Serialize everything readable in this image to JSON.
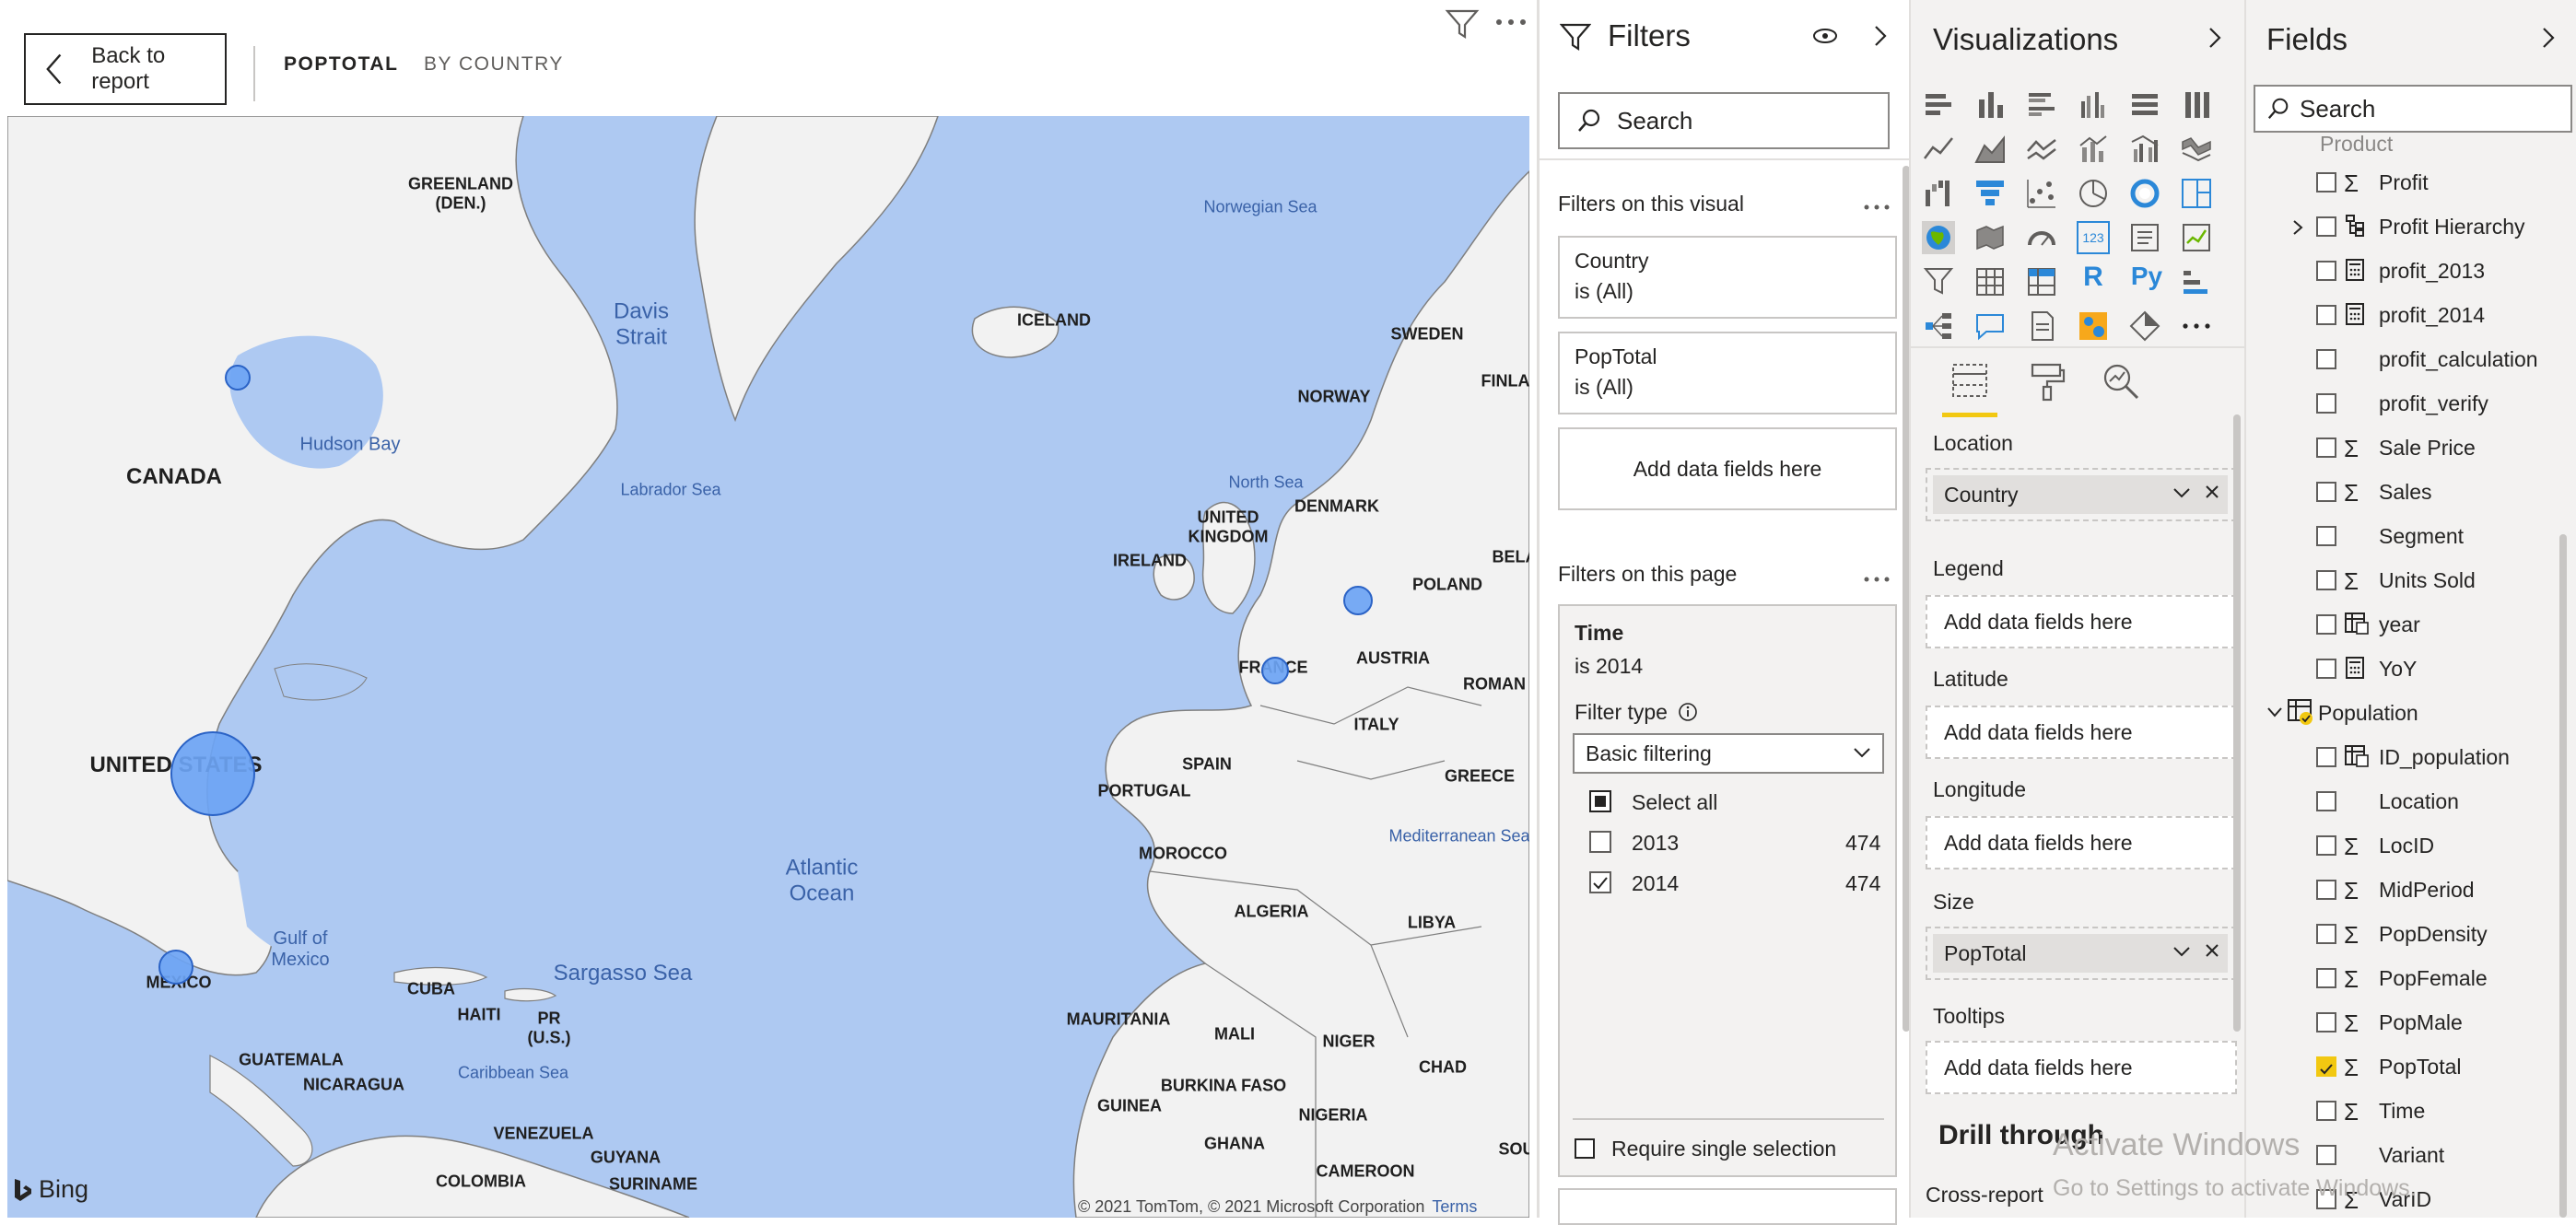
{
  "report": {
    "back_label": "Back to report",
    "tabs": [
      {
        "label": "POPTOTAL",
        "active": true
      },
      {
        "label": "BY COUNTRY",
        "active": false
      }
    ],
    "map": {
      "provider": "Bing",
      "copyright": "© 2021 TomTom, © 2021 Microsoft Corporation",
      "terms": "Terms",
      "labels": {
        "greenland": "GREENLAND\n(DEN.)",
        "iceland": "ICELAND",
        "sweden": "SWEDEN",
        "finland": "FINLA",
        "norway": "NORWAY",
        "canada": "CANADA",
        "uk": "UNITED\nKINGDOM",
        "ireland": "IRELAND",
        "denmark": "DENMARK",
        "poland": "POLAND",
        "belarus": "BELA",
        "france": "FRANCE",
        "austria": "AUSTRIA",
        "romania": "ROMAN",
        "italy": "ITALY",
        "us": "UNITED STATES",
        "spain": "SPAIN",
        "portugal": "PORTUGAL",
        "greece": "GREECE",
        "morocco": "MOROCCO",
        "algeria": "ALGERIA",
        "libya": "LIBYA",
        "mexico": "MEXICO",
        "cuba": "CUBA",
        "haiti": "HAITI",
        "pr": "PR\n(U.S.)",
        "mauritania": "MAURITANIA",
        "mali": "MALI",
        "niger": "NIGER",
        "chad": "CHAD",
        "guatemala": "GUATEMALA",
        "nicaragua": "NICARAGUA",
        "burkina": "BURKINA FASO",
        "guinea": "GUINEA",
        "nigeria": "NIGERIA",
        "venezuela": "VENEZUELA",
        "guyana": "GUYANA",
        "suriname": "SURINAME",
        "ghana": "GHANA",
        "cameroon": "CAMEROON",
        "colombia": "COLOMBIA",
        "south": "SOU",
        "davis": "Davis\nStrait",
        "hudson": "Hudson Bay",
        "labrador": "Labrador Sea",
        "norwegian": "Norwegian Sea",
        "northsea": "North Sea",
        "atlantic": "Atlantic\nOcean",
        "gulf": "Gulf of\nMexico",
        "sargasso": "Sargasso Sea",
        "caribbean": "Caribbean Sea",
        "mediterranean": "Mediterranean Sea"
      }
    }
  },
  "filters": {
    "title": "Filters",
    "search_placeholder": "Search",
    "on_visual_label": "Filters on this visual",
    "visual_filters": [
      {
        "field": "Country",
        "state": "is (All)"
      },
      {
        "field": "PopTotal",
        "state": "is (All)"
      }
    ],
    "add_fields": "Add data fields here",
    "on_page_label": "Filters on this page",
    "page_filter": {
      "field": "Time",
      "state": "is 2014",
      "filter_type_label": "Filter type",
      "filter_type_value": "Basic filtering",
      "select_all": "Select all",
      "options": [
        {
          "label": "2013",
          "count": "474",
          "checked": false
        },
        {
          "label": "2014",
          "count": "474",
          "checked": true
        }
      ],
      "require_single": "Require single selection"
    }
  },
  "visualizations": {
    "title": "Visualizations",
    "wells": [
      {
        "label": "Location",
        "value": "Country"
      },
      {
        "label": "Legend",
        "value": "Add data fields here"
      },
      {
        "label": "Latitude",
        "value": "Add data fields here"
      },
      {
        "label": "Longitude",
        "value": "Add data fields here"
      },
      {
        "label": "Size",
        "value": "PopTotal"
      },
      {
        "label": "Tooltips",
        "value": "Add data fields here"
      }
    ],
    "drill_through": "Drill through",
    "cross_report": "Cross-report",
    "watermark": "Activate Windows",
    "watermark_sub": "Go to Settings to activate Windows.",
    "icon_r": "R",
    "icon_py": "Py",
    "icon_123": "123"
  },
  "fields": {
    "title": "Fields",
    "search_placeholder": "Search",
    "cut_item": "Product",
    "items": [
      {
        "label": "Profit",
        "icon": "sigma",
        "checked": false
      },
      {
        "label": "Profit Hierarchy",
        "icon": "hierarchy",
        "checked": false,
        "expand": true
      },
      {
        "label": "profit_2013",
        "icon": "calc",
        "checked": false
      },
      {
        "label": "profit_2014",
        "icon": "calc",
        "checked": false
      },
      {
        "label": "profit_calculation",
        "icon": "none",
        "checked": false
      },
      {
        "label": "profit_verify",
        "icon": "none",
        "checked": false
      },
      {
        "label": "Sale Price",
        "icon": "sigma",
        "checked": false
      },
      {
        "label": "Sales",
        "icon": "sigma",
        "checked": false
      },
      {
        "label": "Segment",
        "icon": "none",
        "checked": false
      },
      {
        "label": "Units Sold",
        "icon": "sigma",
        "checked": false
      },
      {
        "label": "year",
        "icon": "table-calc",
        "checked": false
      },
      {
        "label": "YoY",
        "icon": "calc",
        "checked": false
      }
    ],
    "table": "Population",
    "table_items": [
      {
        "label": "ID_population",
        "icon": "table-calc",
        "checked": false
      },
      {
        "label": "Location",
        "icon": "none",
        "checked": false
      },
      {
        "label": "LocID",
        "icon": "sigma",
        "checked": false
      },
      {
        "label": "MidPeriod",
        "icon": "sigma",
        "checked": false
      },
      {
        "label": "PopDensity",
        "icon": "sigma",
        "checked": false
      },
      {
        "label": "PopFemale",
        "icon": "sigma",
        "checked": false
      },
      {
        "label": "PopMale",
        "icon": "sigma",
        "checked": false
      },
      {
        "label": "PopTotal",
        "icon": "sigma",
        "checked": true
      },
      {
        "label": "Time",
        "icon": "sigma",
        "checked": false
      },
      {
        "label": "Variant",
        "icon": "none",
        "checked": false
      },
      {
        "label": "VarID",
        "icon": "sigma",
        "checked": false
      }
    ]
  },
  "colors": {
    "accent": "#f2c811",
    "bubble": "#6ca4f4",
    "water": "#aec9f2",
    "land": "#f2f2f2"
  }
}
